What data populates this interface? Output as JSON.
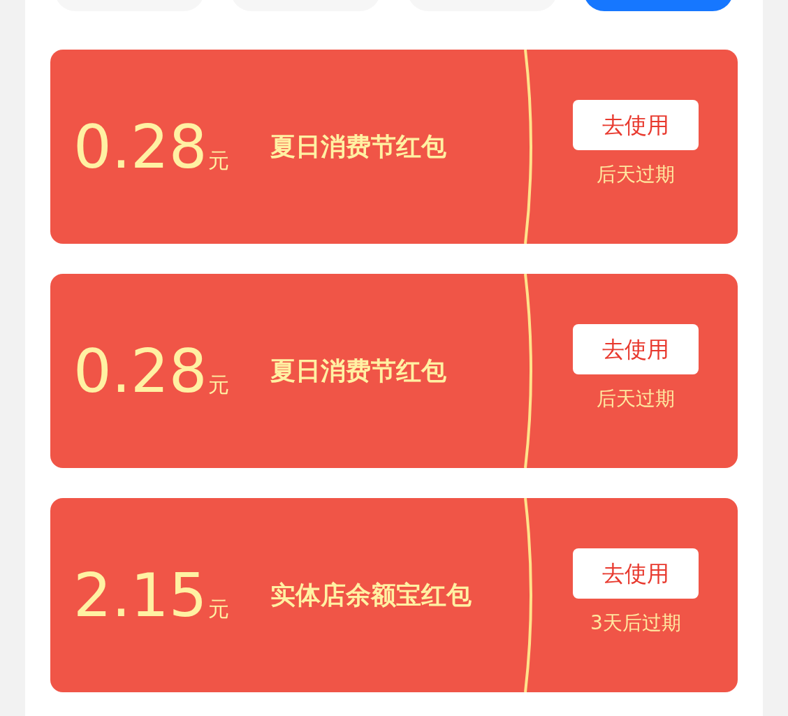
{
  "filter_tabs": [
    {
      "selected": false
    },
    {
      "selected": false
    },
    {
      "selected": false
    },
    {
      "selected": true
    }
  ],
  "coupons": [
    {
      "amount": "0.28",
      "unit": "元",
      "title": "夏日消费节红包",
      "button": "去使用",
      "expiry": "后天过期"
    },
    {
      "amount": "0.28",
      "unit": "元",
      "title": "夏日消费节红包",
      "button": "去使用",
      "expiry": "后天过期"
    },
    {
      "amount": "2.15",
      "unit": "元",
      "title": "实体店余额宝红包",
      "button": "去使用",
      "expiry": "3天后过期"
    }
  ]
}
